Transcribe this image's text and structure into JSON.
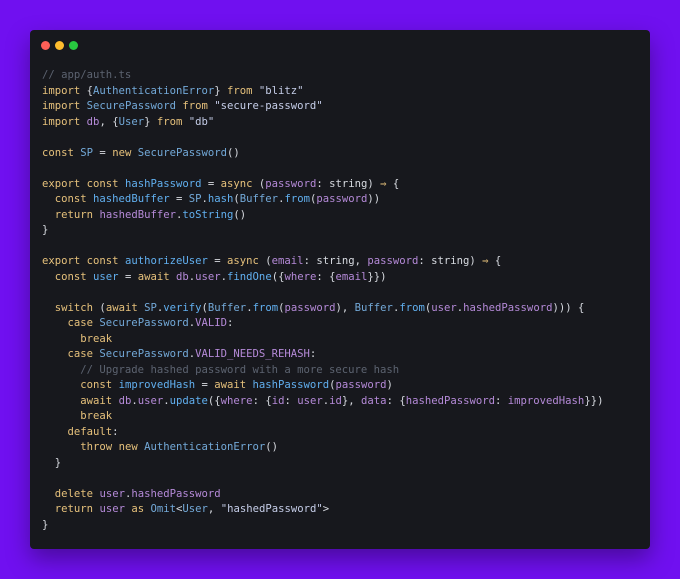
{
  "window": {
    "controls": [
      {
        "name": "close",
        "color": "#ff5f57"
      },
      {
        "name": "minimize",
        "color": "#febc2e"
      },
      {
        "name": "zoom",
        "color": "#28c840"
      }
    ]
  },
  "colors": {
    "background": "#7010f0",
    "editor": "#17181d",
    "comment": "#5c6370",
    "keyword": "#e5c07b",
    "string": "#c5cde8",
    "function": "#61afef",
    "class": "#73a9d8",
    "variable": "#b58ad8",
    "plain": "#d7dae0"
  },
  "code": {
    "lines": [
      [
        [
          "comment",
          "// app/auth.ts"
        ]
      ],
      [
        [
          "kw",
          "import"
        ],
        [
          "plain",
          " {"
        ],
        [
          "cls",
          "AuthenticationError"
        ],
        [
          "plain",
          "} "
        ],
        [
          "kw",
          "from"
        ],
        [
          "plain",
          " "
        ],
        [
          "str",
          "\"blitz\""
        ]
      ],
      [
        [
          "kw",
          "import"
        ],
        [
          "plain",
          " "
        ],
        [
          "cls",
          "SecurePassword"
        ],
        [
          "plain",
          " "
        ],
        [
          "kw",
          "from"
        ],
        [
          "plain",
          " "
        ],
        [
          "str",
          "\"secure-password\""
        ]
      ],
      [
        [
          "kw",
          "import"
        ],
        [
          "plain",
          " "
        ],
        [
          "var",
          "db"
        ],
        [
          "plain",
          ", {"
        ],
        [
          "cls",
          "User"
        ],
        [
          "plain",
          "} "
        ],
        [
          "kw",
          "from"
        ],
        [
          "plain",
          " "
        ],
        [
          "str",
          "\"db\""
        ]
      ],
      [],
      [
        [
          "kw",
          "const"
        ],
        [
          "plain",
          " "
        ],
        [
          "cls",
          "SP"
        ],
        [
          "plain",
          " = "
        ],
        [
          "kw",
          "new"
        ],
        [
          "plain",
          " "
        ],
        [
          "cls",
          "SecurePassword"
        ],
        [
          "plain",
          "()"
        ]
      ],
      [],
      [
        [
          "kw",
          "export"
        ],
        [
          "plain",
          " "
        ],
        [
          "kw",
          "const"
        ],
        [
          "plain",
          " "
        ],
        [
          "fn",
          "hashPassword"
        ],
        [
          "plain",
          " = "
        ],
        [
          "kw",
          "async"
        ],
        [
          "plain",
          " ("
        ],
        [
          "var",
          "password"
        ],
        [
          "plain",
          ": string) "
        ],
        [
          "kw",
          "⇒"
        ],
        [
          "plain",
          " {"
        ]
      ],
      [
        [
          "plain",
          "  "
        ],
        [
          "kw",
          "const"
        ],
        [
          "plain",
          " "
        ],
        [
          "fn",
          "hashedBuffer"
        ],
        [
          "plain",
          " = "
        ],
        [
          "cls",
          "SP"
        ],
        [
          "plain",
          "."
        ],
        [
          "fn",
          "hash"
        ],
        [
          "plain",
          "("
        ],
        [
          "cls",
          "Buffer"
        ],
        [
          "plain",
          "."
        ],
        [
          "fn",
          "from"
        ],
        [
          "plain",
          "("
        ],
        [
          "var",
          "password"
        ],
        [
          "plain",
          "))"
        ]
      ],
      [
        [
          "plain",
          "  "
        ],
        [
          "kw",
          "return"
        ],
        [
          "plain",
          " "
        ],
        [
          "var",
          "hashedBuffer"
        ],
        [
          "plain",
          "."
        ],
        [
          "fn",
          "toString"
        ],
        [
          "plain",
          "()"
        ]
      ],
      [
        [
          "plain",
          "}"
        ]
      ],
      [],
      [
        [
          "kw",
          "export"
        ],
        [
          "plain",
          " "
        ],
        [
          "kw",
          "const"
        ],
        [
          "plain",
          " "
        ],
        [
          "fn",
          "authorizeUser"
        ],
        [
          "plain",
          " = "
        ],
        [
          "kw",
          "async"
        ],
        [
          "plain",
          " ("
        ],
        [
          "var",
          "email"
        ],
        [
          "plain",
          ": string, "
        ],
        [
          "var",
          "password"
        ],
        [
          "plain",
          ": string) "
        ],
        [
          "kw",
          "⇒"
        ],
        [
          "plain",
          " {"
        ]
      ],
      [
        [
          "plain",
          "  "
        ],
        [
          "kw",
          "const"
        ],
        [
          "plain",
          " "
        ],
        [
          "fn",
          "user"
        ],
        [
          "plain",
          " = "
        ],
        [
          "kw",
          "await"
        ],
        [
          "plain",
          " "
        ],
        [
          "var",
          "db"
        ],
        [
          "plain",
          "."
        ],
        [
          "var",
          "user"
        ],
        [
          "plain",
          "."
        ],
        [
          "fn",
          "findOne"
        ],
        [
          "plain",
          "({"
        ],
        [
          "var",
          "where"
        ],
        [
          "plain",
          ": {"
        ],
        [
          "var",
          "email"
        ],
        [
          "plain",
          "}})"
        ]
      ],
      [],
      [
        [
          "plain",
          "  "
        ],
        [
          "kw",
          "switch"
        ],
        [
          "plain",
          " ("
        ],
        [
          "kw",
          "await"
        ],
        [
          "plain",
          " "
        ],
        [
          "cls",
          "SP"
        ],
        [
          "plain",
          "."
        ],
        [
          "fn",
          "verify"
        ],
        [
          "plain",
          "("
        ],
        [
          "cls",
          "Buffer"
        ],
        [
          "plain",
          "."
        ],
        [
          "fn",
          "from"
        ],
        [
          "plain",
          "("
        ],
        [
          "var",
          "password"
        ],
        [
          "plain",
          "), "
        ],
        [
          "cls",
          "Buffer"
        ],
        [
          "plain",
          "."
        ],
        [
          "fn",
          "from"
        ],
        [
          "plain",
          "("
        ],
        [
          "var",
          "user"
        ],
        [
          "plain",
          "."
        ],
        [
          "var",
          "hashedPassword"
        ],
        [
          "plain",
          "))) {"
        ]
      ],
      [
        [
          "plain",
          "    "
        ],
        [
          "kw",
          "case"
        ],
        [
          "plain",
          " "
        ],
        [
          "cls",
          "SecurePassword"
        ],
        [
          "plain",
          "."
        ],
        [
          "var",
          "VALID"
        ],
        [
          "plain",
          ":"
        ]
      ],
      [
        [
          "plain",
          "      "
        ],
        [
          "kw",
          "break"
        ]
      ],
      [
        [
          "plain",
          "    "
        ],
        [
          "kw",
          "case"
        ],
        [
          "plain",
          " "
        ],
        [
          "cls",
          "SecurePassword"
        ],
        [
          "plain",
          "."
        ],
        [
          "var",
          "VALID_NEEDS_REHASH"
        ],
        [
          "plain",
          ":"
        ]
      ],
      [
        [
          "plain",
          "      "
        ],
        [
          "comment",
          "// Upgrade hashed password with a more secure hash"
        ]
      ],
      [
        [
          "plain",
          "      "
        ],
        [
          "kw",
          "const"
        ],
        [
          "plain",
          " "
        ],
        [
          "fn",
          "improvedHash"
        ],
        [
          "plain",
          " = "
        ],
        [
          "kw",
          "await"
        ],
        [
          "plain",
          " "
        ],
        [
          "fn",
          "hashPassword"
        ],
        [
          "plain",
          "("
        ],
        [
          "var",
          "password"
        ],
        [
          "plain",
          ")"
        ]
      ],
      [
        [
          "plain",
          "      "
        ],
        [
          "kw",
          "await"
        ],
        [
          "plain",
          " "
        ],
        [
          "var",
          "db"
        ],
        [
          "plain",
          "."
        ],
        [
          "var",
          "user"
        ],
        [
          "plain",
          "."
        ],
        [
          "fn",
          "update"
        ],
        [
          "plain",
          "({"
        ],
        [
          "var",
          "where"
        ],
        [
          "plain",
          ": {"
        ],
        [
          "var",
          "id"
        ],
        [
          "plain",
          ": "
        ],
        [
          "var",
          "user"
        ],
        [
          "plain",
          "."
        ],
        [
          "var",
          "id"
        ],
        [
          "plain",
          "}, "
        ],
        [
          "var",
          "data"
        ],
        [
          "plain",
          ": {"
        ],
        [
          "var",
          "hashedPassword"
        ],
        [
          "plain",
          ": "
        ],
        [
          "var",
          "improvedHash"
        ],
        [
          "plain",
          "}})"
        ]
      ],
      [
        [
          "plain",
          "      "
        ],
        [
          "kw",
          "break"
        ]
      ],
      [
        [
          "plain",
          "    "
        ],
        [
          "kw",
          "default"
        ],
        [
          "plain",
          ":"
        ]
      ],
      [
        [
          "plain",
          "      "
        ],
        [
          "kw",
          "throw"
        ],
        [
          "plain",
          " "
        ],
        [
          "kw",
          "new"
        ],
        [
          "plain",
          " "
        ],
        [
          "cls",
          "AuthenticationError"
        ],
        [
          "plain",
          "()"
        ]
      ],
      [
        [
          "plain",
          "  }"
        ]
      ],
      [],
      [
        [
          "plain",
          "  "
        ],
        [
          "kw",
          "delete"
        ],
        [
          "plain",
          " "
        ],
        [
          "var",
          "user"
        ],
        [
          "plain",
          "."
        ],
        [
          "var",
          "hashedPassword"
        ]
      ],
      [
        [
          "plain",
          "  "
        ],
        [
          "kw",
          "return"
        ],
        [
          "plain",
          " "
        ],
        [
          "var",
          "user"
        ],
        [
          "plain",
          " "
        ],
        [
          "kw",
          "as"
        ],
        [
          "plain",
          " "
        ],
        [
          "cls",
          "Omit"
        ],
        [
          "plain",
          "<"
        ],
        [
          "cls",
          "User"
        ],
        [
          "plain",
          ", "
        ],
        [
          "str",
          "\"hashedPassword\""
        ],
        [
          "plain",
          ">"
        ]
      ],
      [
        [
          "plain",
          "}"
        ]
      ]
    ]
  }
}
